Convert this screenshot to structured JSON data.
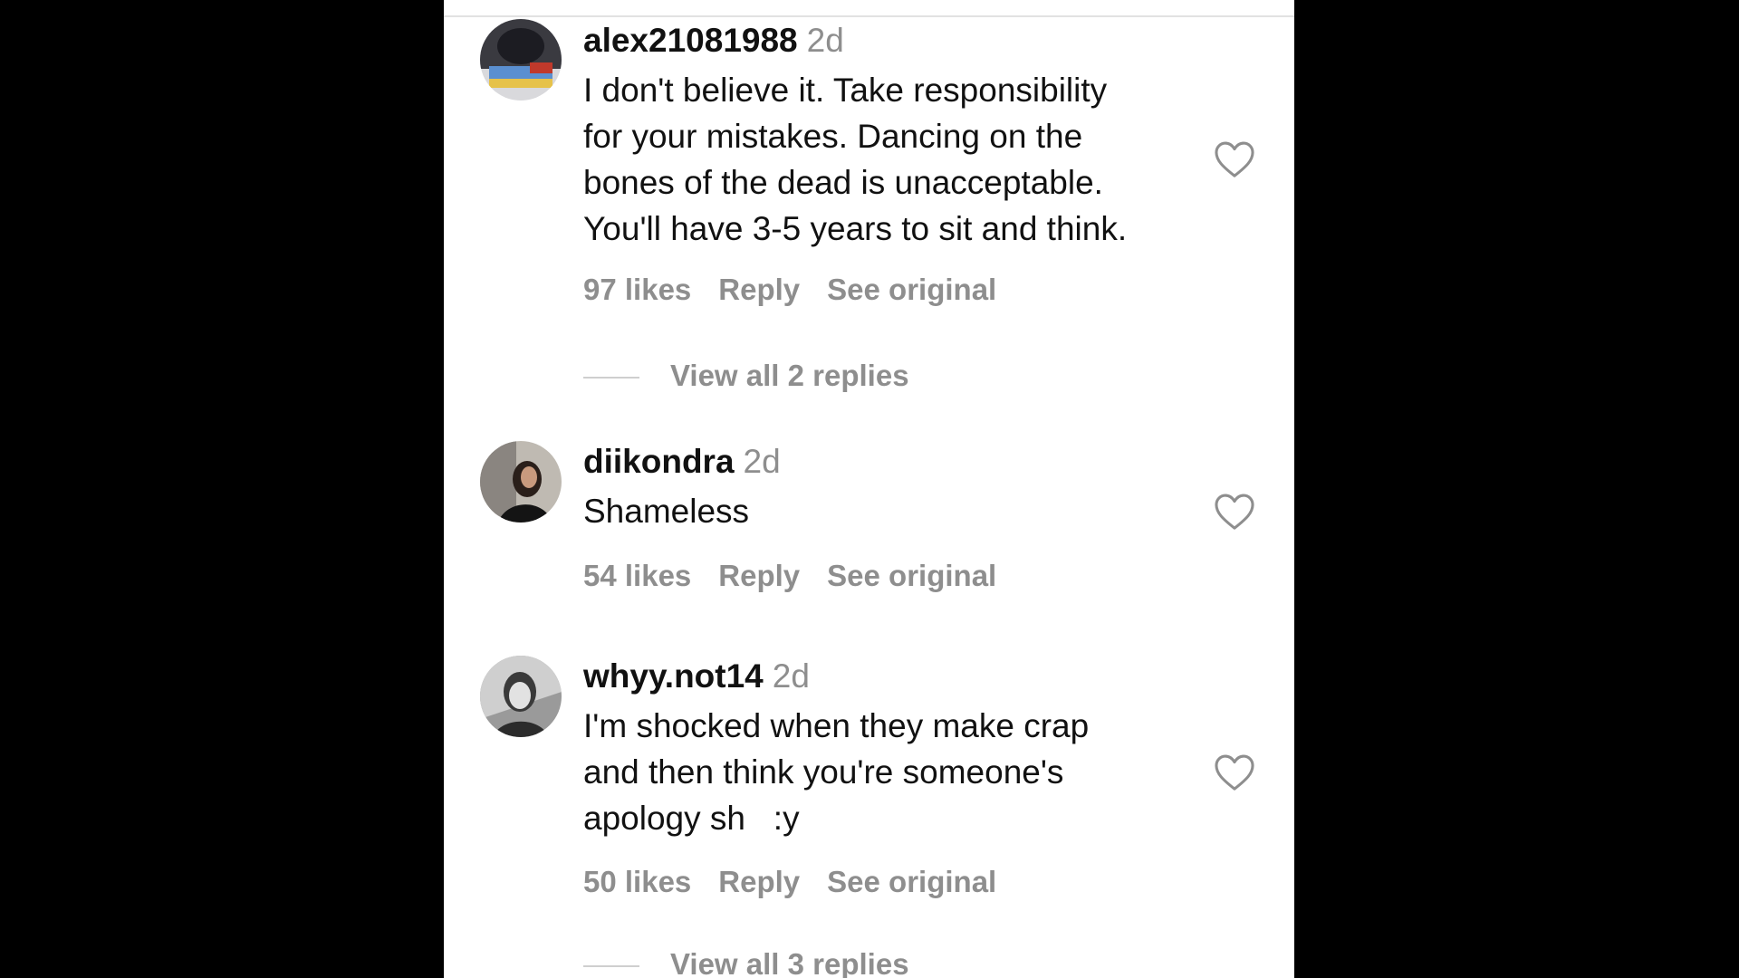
{
  "comments": [
    {
      "username": "alex21081988",
      "time": "2d",
      "lines": [
        "I don't believe it. Take responsibility",
        "for your mistakes. Dancing on the",
        "bones of the dead is unacceptable.",
        "You'll have 3-5 years to sit and think."
      ],
      "likes": "97 likes",
      "reply": "Reply",
      "see_original": "See original",
      "view_replies": "View all 2 replies"
    },
    {
      "username": "diikondra",
      "time": "2d",
      "lines": [
        "Shameless"
      ],
      "likes": "54 likes",
      "reply": "Reply",
      "see_original": "See original"
    },
    {
      "username": "whyy.not14",
      "time": "2d",
      "lines": [
        "I'm shocked when they make crap",
        "and then think you're someone's",
        "apology sh   :y"
      ],
      "likes": "50 likes",
      "reply": "Reply",
      "see_original": "See original",
      "view_replies": "View all 3 replies"
    }
  ],
  "icons": {
    "like": "heart-outline-icon",
    "avatar": "user-avatar"
  },
  "colors": {
    "background": "#000000",
    "panel": "#ffffff",
    "primary_text": "#111111",
    "secondary_text": "#8e8e8e"
  }
}
